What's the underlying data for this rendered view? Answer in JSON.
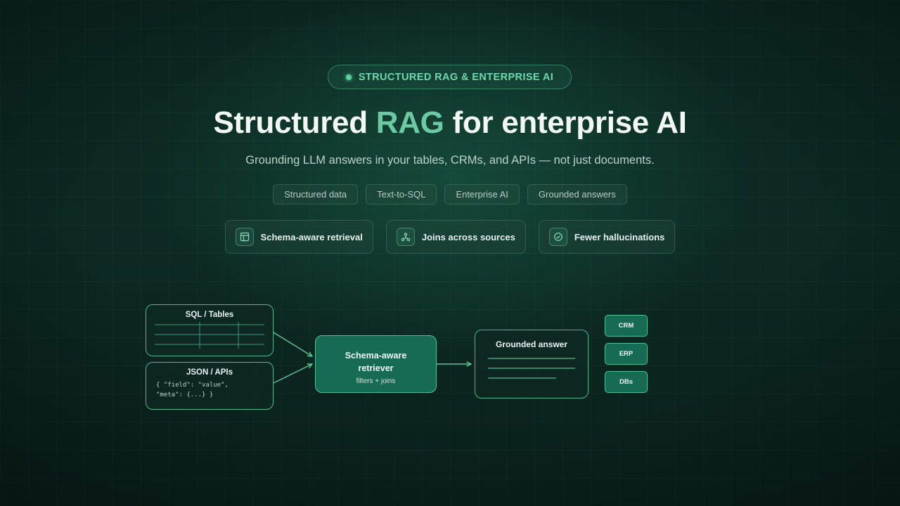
{
  "badge": {
    "label": "STRUCTURED RAG & ENTERPRISE AI"
  },
  "hero": {
    "title_pre": "Structured ",
    "title_accent": "RAG",
    "title_post": " for enterprise AI",
    "subtitle": "Grounding LLM answers in your tables, CRMs, and APIs — not just documents."
  },
  "tags": [
    "Structured data",
    "Text-to-SQL",
    "Enterprise AI",
    "Grounded answers"
  ],
  "features": [
    {
      "label": "Schema-aware retrieval",
      "icon": "table-icon"
    },
    {
      "label": "Joins across sources",
      "icon": "nodes-icon"
    },
    {
      "label": "Fewer hallucinations",
      "icon": "check-circle-icon"
    }
  ],
  "diagram": {
    "sql_box": {
      "title": "SQL / Tables"
    },
    "json_box": {
      "title": "JSON / APIs",
      "code_line_1": "{ \"field\": \"value\",",
      "code_line_2": "\"meta\": {...} }"
    },
    "retriever": {
      "title_line_1": "Schema-aware",
      "title_line_2": "retriever",
      "subtitle": "filters + joins"
    },
    "answer_box": {
      "title": "Grounded answer"
    },
    "sources": [
      "CRM",
      "ERP",
      "DBs"
    ]
  },
  "colors": {
    "accent": "#6ccaa2",
    "box_border": "#4fb890",
    "retriever_fill": "#176a53",
    "background": "#0c2a23"
  }
}
